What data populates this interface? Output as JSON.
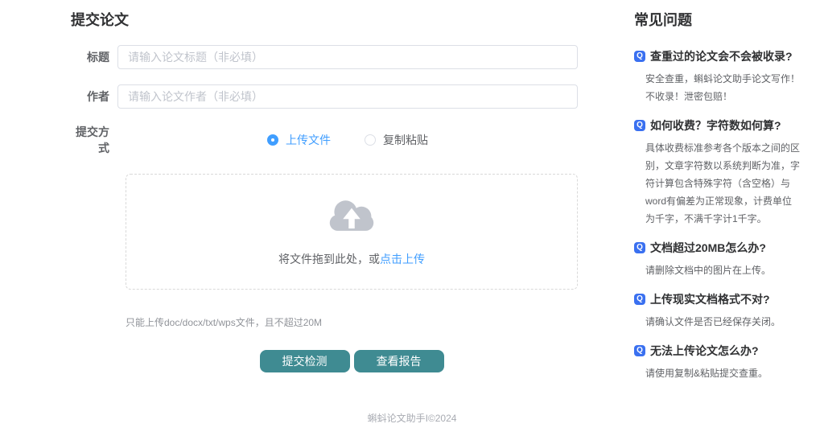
{
  "page": {
    "title": "提交论文",
    "footer": "蝌蚪论文助手I©2024"
  },
  "form": {
    "fields": [
      {
        "label": "标题",
        "value": "",
        "placeholder": "请输入论文标题（非必填）"
      },
      {
        "label": "作者",
        "value": "",
        "placeholder": "请输入论文作者（非必填）"
      }
    ],
    "method": {
      "label": "提交方式",
      "options": [
        {
          "label": "上传文件",
          "selected": true
        },
        {
          "label": "复制粘贴",
          "selected": false
        }
      ]
    },
    "upload": {
      "drag_text": "将文件拖到此处，或",
      "click_text": "点击上传",
      "tip": "只能上传doc/docx/txt/wps文件，且不超过20M",
      "cloud_icon": "cloud-upload-icon"
    },
    "buttons": [
      {
        "label": "提交检测"
      },
      {
        "label": "查看报告"
      }
    ]
  },
  "faq": {
    "title": "常见问题",
    "q_icon_glyph": "Q",
    "items": [
      {
        "question": "查重过的论文会不会被收录?",
        "answer": "安全查重，蝌蚪论文助手论文写作！不收录！泄密包赔！"
      },
      {
        "question": "如何收费？字符数如何算?",
        "answer": "具体收费标准参考各个版本之间的区别，文章字符数以系统判断为准，字符计算包含特殊字符（含空格）与word有偏差为正常现象，计费单位为千字，不满千字计1千字。"
      },
      {
        "question": "文档超过20MB怎么办?",
        "answer": "请删除文档中的图片在上传。"
      },
      {
        "question": "上传现实文档格式不对?",
        "answer": "请确认文件是否已经保存关闭。"
      },
      {
        "question": "无法上传论文怎么办?",
        "answer": "请使用复制&粘贴提交查重。"
      }
    ]
  },
  "colors": {
    "accent_blue": "#409eff",
    "q_icon_blue": "#3a70f0",
    "button_teal": "#3f8b92",
    "placeholder_gray": "#c0c4cc",
    "border_gray": "#dcdfe6"
  }
}
